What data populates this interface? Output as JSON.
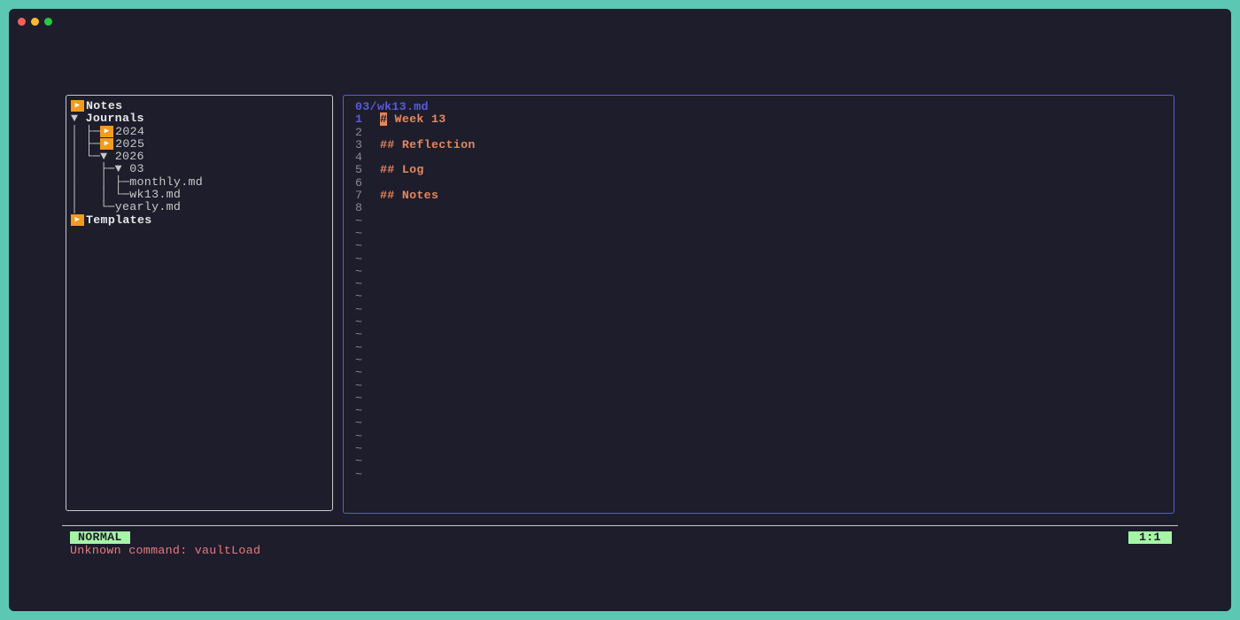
{
  "window": {
    "controls": [
      "close",
      "minimize",
      "maximize"
    ]
  },
  "tree": {
    "rows": [
      {
        "prefix": "",
        "expanded": false,
        "icon": "folder-icon",
        "label": "Notes",
        "bold": true
      },
      {
        "prefix": "▼ ",
        "expanded": true,
        "icon": "",
        "label": "Journals",
        "bold": true
      },
      {
        "prefix": "│ ├─",
        "expanded": false,
        "icon": "folder-icon",
        "label": "2024",
        "bold": false
      },
      {
        "prefix": "│ ├─",
        "expanded": false,
        "icon": "folder-icon",
        "label": "2025",
        "bold": false
      },
      {
        "prefix": "│ └─▼ ",
        "expanded": true,
        "icon": "",
        "label": "2026",
        "bold": false
      },
      {
        "prefix": "│   ├─▼ ",
        "expanded": true,
        "icon": "",
        "label": "03",
        "bold": false
      },
      {
        "prefix": "│   │ ├─",
        "expanded": false,
        "icon": "",
        "label": "monthly.md",
        "bold": false
      },
      {
        "prefix": "│   │ └─",
        "expanded": false,
        "icon": "",
        "label": "wk13.md",
        "bold": false
      },
      {
        "prefix": "│   └─",
        "expanded": false,
        "icon": "",
        "label": "yearly.md",
        "bold": false
      },
      {
        "prefix": "",
        "expanded": false,
        "icon": "folder-icon",
        "label": "Templates",
        "bold": true
      }
    ]
  },
  "editor": {
    "file_title": "03/wk13.md",
    "lines": [
      {
        "num": "1",
        "text": "# Week 13",
        "heading": true,
        "current": true
      },
      {
        "num": "2",
        "text": "",
        "heading": false,
        "current": false
      },
      {
        "num": "3",
        "text": "## Reflection",
        "heading": true,
        "current": false
      },
      {
        "num": "4",
        "text": "",
        "heading": false,
        "current": false
      },
      {
        "num": "5",
        "text": "## Log",
        "heading": true,
        "current": false
      },
      {
        "num": "6",
        "text": "",
        "heading": false,
        "current": false
      },
      {
        "num": "7",
        "text": "## Notes",
        "heading": true,
        "current": false
      },
      {
        "num": "8",
        "text": "",
        "heading": false,
        "current": false
      }
    ],
    "tilde_char": "~",
    "tilde_count": 21
  },
  "statusbar": {
    "mode": "NORMAL",
    "position": "1:1",
    "message": "Unknown command: vaultLoad"
  },
  "colors": {
    "background": "#1d1d2c",
    "frame": "#5cc8b4",
    "accent": "#5a5adf",
    "heading": "#e8865a",
    "folder_icon": "#f39a1f",
    "status_badge": "#a6f5a6",
    "error": "#e87c7c"
  }
}
